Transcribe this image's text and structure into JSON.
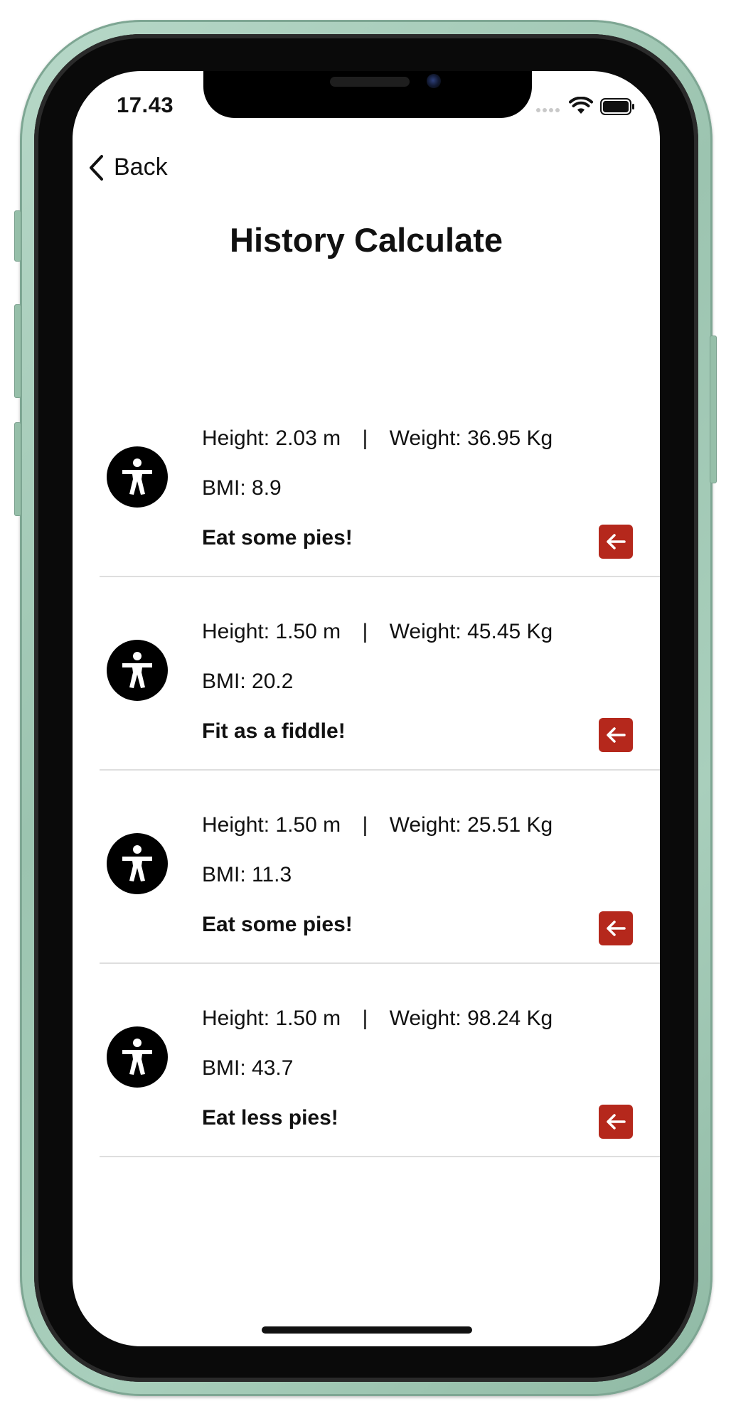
{
  "status_bar": {
    "time": "17.43"
  },
  "nav": {
    "back_label": "Back",
    "title": "History Calculate"
  },
  "labels": {
    "height": "Height:",
    "weight": "Weight:",
    "bmi": "BMI:",
    "separator": "|"
  },
  "history": [
    {
      "height": "2.03 m",
      "weight": "36.95 Kg",
      "bmi": "8.9",
      "advice": "Eat some pies!"
    },
    {
      "height": "1.50 m",
      "weight": "45.45 Kg",
      "bmi": "20.2",
      "advice": "Fit as a fiddle!"
    },
    {
      "height": "1.50 m",
      "weight": "25.51 Kg",
      "bmi": "11.3",
      "advice": "Eat some pies!"
    },
    {
      "height": "1.50 m",
      "weight": "98.24 Kg",
      "bmi": "43.7",
      "advice": "Eat less pies!"
    }
  ],
  "icons": {
    "back": "chevron-left-icon",
    "avatar": "accessibility-person-icon",
    "delete": "arrow-left-icon"
  },
  "colors": {
    "delete_button": "#b5281c",
    "avatar_background": "#000000",
    "frame": "#a9cfbc"
  }
}
